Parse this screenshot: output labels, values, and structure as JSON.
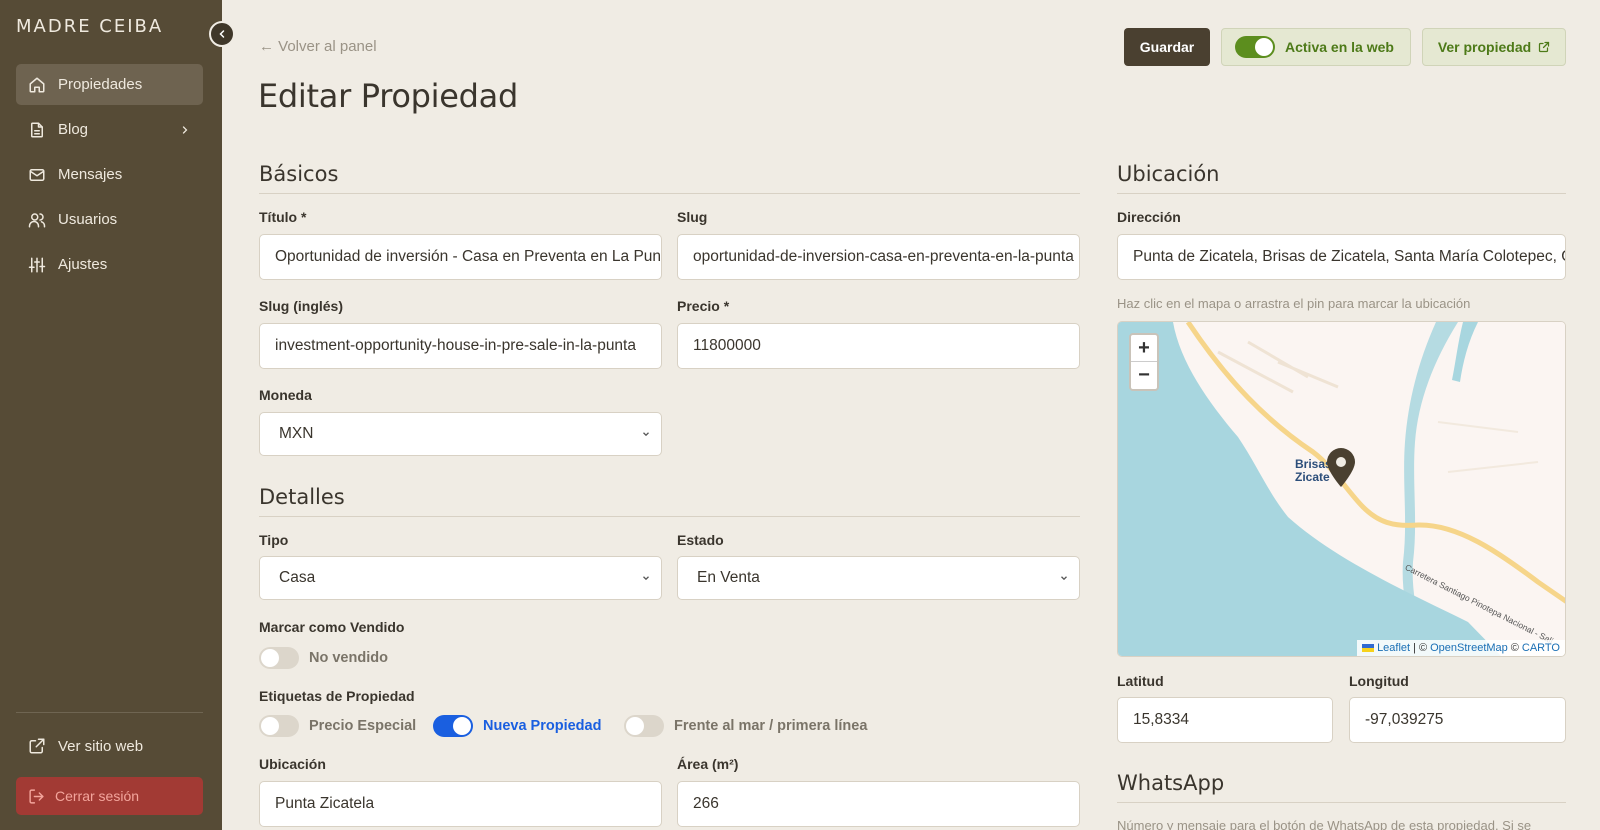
{
  "brand": "MADRE CEIBA",
  "sidebar": {
    "items": [
      {
        "label": "Propiedades",
        "icon": "home-icon"
      },
      {
        "label": "Blog",
        "icon": "document-icon"
      },
      {
        "label": "Mensajes",
        "icon": "mail-icon"
      },
      {
        "label": "Usuarios",
        "icon": "users-icon"
      },
      {
        "label": "Ajustes",
        "icon": "sliders-icon"
      }
    ],
    "view_site": "Ver sitio web",
    "logout": "Cerrar sesión"
  },
  "header": {
    "back_link": "← Volver al panel",
    "title": "Editar Propiedad",
    "save_label": "Guardar",
    "active_label": "Activa en la web",
    "view_label": "Ver propiedad"
  },
  "basics": {
    "title": "Básicos",
    "titulo_label": "Título *",
    "titulo_value": "Oportunidad de inversión - Casa en Preventa en La Punta",
    "slug_label": "Slug",
    "slug_value": "oportunidad-de-inversion-casa-en-preventa-en-la-punta",
    "slug_en_label": "Slug (inglés)",
    "slug_en_value": "investment-opportunity-house-in-pre-sale-in-la-punta",
    "precio_label": "Precio *",
    "precio_value": "11800000",
    "moneda_label": "Moneda",
    "moneda_value": "MXN"
  },
  "details": {
    "title": "Detalles",
    "tipo_label": "Tipo",
    "tipo_value": "Casa",
    "estado_label": "Estado",
    "estado_value": "En Venta",
    "sold_label": "Marcar como Vendido",
    "sold_toggle": "No vendido",
    "tags_label": "Etiquetas de Propiedad",
    "tags": [
      {
        "label": "Precio Especial",
        "on": false
      },
      {
        "label": "Nueva Propiedad",
        "on": true
      },
      {
        "label": "Frente al mar / primera línea",
        "on": false
      }
    ],
    "ubicacion_label": "Ubicación",
    "ubicacion_value": "Punta Zicatela",
    "area_label": "Área (m²)",
    "area_value": "266"
  },
  "location": {
    "title": "Ubicación",
    "direccion_label": "Dirección",
    "direccion_value": "Punta de Zicatela, Brisas de Zicatela, Santa María Colotepec, Oaxaca",
    "hint": "Haz clic en el mapa o arrastra el pin para marcar la ubicación",
    "map_label_1": "Brisas",
    "map_label_2": "Zicate",
    "road_label": "Carretera Santiago Pinotepa Nacional - Sali",
    "zoom_in": "+",
    "zoom_out": "−",
    "attribution_leaflet": "Leaflet",
    "attribution_sep1": "| ©",
    "attribution_osm": "OpenStreetMap",
    "attribution_sep2": "©",
    "attribution_carto": "CARTO",
    "lat_label": "Latitud",
    "lat_value": "15,8334",
    "lng_label": "Longitud",
    "lng_value": "-97,039275"
  },
  "whatsapp": {
    "title": "WhatsApp",
    "desc": "Número y mensaje para el botón de WhatsApp de esta propiedad. Si se"
  },
  "colors": {
    "sidebar": "#564b36",
    "background": "#f0ece4",
    "accent_green": "#5c8e1e",
    "toggle_blue": "#1a5fe0",
    "logout_red": "#a23a34"
  }
}
